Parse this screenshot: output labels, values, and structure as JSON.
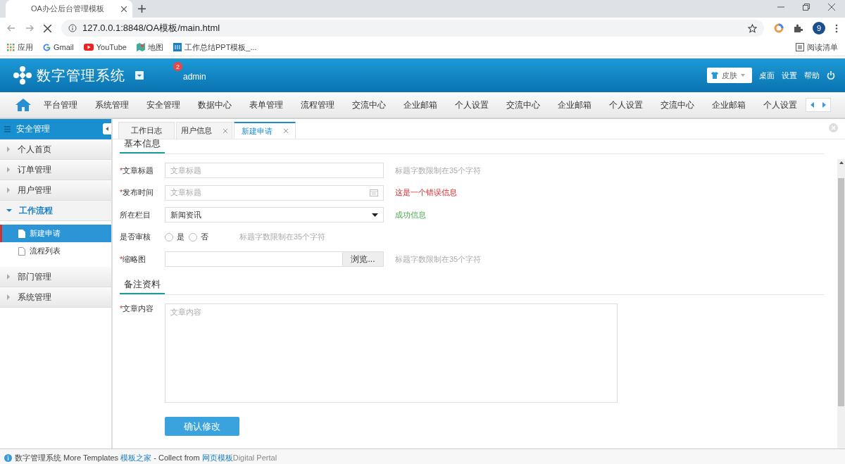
{
  "browser": {
    "tab_title": "OA办公后台管理模板",
    "url": "127.0.0.1:8848/OA模板/main.html",
    "avatar_letter": "9",
    "bookmarks": [
      {
        "label": "应用",
        "kind": "apps"
      },
      {
        "label": "Gmail",
        "kind": "gmail"
      },
      {
        "label": "YouTube",
        "kind": "youtube"
      },
      {
        "label": "地图",
        "kind": "maps"
      },
      {
        "label": "工作总结PPT模板_...",
        "kind": "site"
      }
    ],
    "reading_list": "阅读清单"
  },
  "header": {
    "logo_text": "数字管理系统",
    "notification_count": "2",
    "username": "admin",
    "skin_button": "皮肤",
    "links": [
      "桌面",
      "设置",
      "帮助"
    ]
  },
  "nav": {
    "items": [
      "平台管理",
      "系统管理",
      "安全管理",
      "数据中心",
      "表单管理",
      "流程管理",
      "交流中心",
      "企业邮箱",
      "个人设置",
      "交流中心",
      "企业邮箱",
      "个人设置",
      "交流中心",
      "企业邮箱",
      "个人设置"
    ]
  },
  "sidebar": {
    "title": "安全管理",
    "groups": [
      {
        "label": "个人首页",
        "expanded": false
      },
      {
        "label": "订单管理",
        "expanded": false
      },
      {
        "label": "用户管理",
        "expanded": false
      },
      {
        "label": "工作流程",
        "expanded": true,
        "children": [
          {
            "label": "新建申请",
            "selected": true
          },
          {
            "label": "流程列表",
            "selected": false
          }
        ]
      },
      {
        "label": "部门管理",
        "expanded": false
      },
      {
        "label": "系统管理",
        "expanded": false
      }
    ]
  },
  "tabs": [
    {
      "label": "工作日志",
      "selected": false,
      "closable": false
    },
    {
      "label": "用户信息",
      "selected": false,
      "closable": true
    },
    {
      "label": "新建申请",
      "selected": true,
      "closable": true
    }
  ],
  "form": {
    "sections": [
      {
        "title": "基本信息",
        "fields": [
          {
            "kind": "text",
            "label": "文章标题",
            "required_mark": "*",
            "placeholder": "文章标题",
            "message": {
              "kind": "hint",
              "text": "标题字数限制在35个字符"
            }
          },
          {
            "kind": "date",
            "label": "发布时间",
            "required_mark": "*",
            "placeholder": "文章标题",
            "message": {
              "kind": "error",
              "text": "这是一个错误信息"
            }
          },
          {
            "kind": "select",
            "label": "所在栏目",
            "value": "新闻资讯",
            "message": {
              "kind": "success",
              "text": "成功信息"
            }
          },
          {
            "kind": "radio",
            "label": "是否审核",
            "options": [
              {
                "label": "是",
                "selected": false
              },
              {
                "label": "否",
                "selected": false
              }
            ],
            "message": {
              "kind": "hint",
              "text": "标题字数限制在35个字符"
            }
          },
          {
            "kind": "file",
            "label": "缩略图",
            "required_mark": "*",
            "button": "浏览...",
            "message": {
              "kind": "hint",
              "text": "标题字数限制在35个字符"
            }
          }
        ]
      },
      {
        "title": "备注资料",
        "fields": [
          {
            "kind": "textarea",
            "label": "文章内容",
            "required_mark": "*",
            "placeholder": "文章内容"
          }
        ]
      }
    ],
    "submit": "确认修改"
  },
  "footer": {
    "app_name": "数字管理系统",
    "text_1": "More Templates",
    "link_1": "模板之家",
    "text_2": "- Collect from",
    "link_2": "网页模板",
    "text_3": "Digital Pertal"
  }
}
